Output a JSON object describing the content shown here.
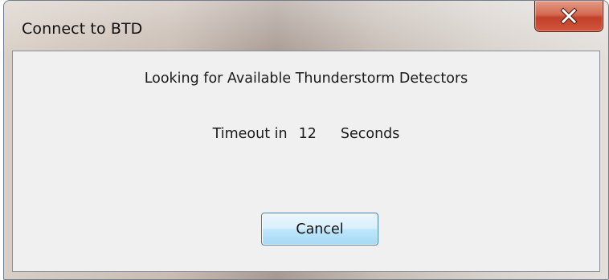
{
  "window": {
    "title": "Connect to BTD"
  },
  "title_bar": {
    "close_icon": "close-icon"
  },
  "dialog": {
    "message": "Looking for Available Thunderstorm Detectors",
    "timeout_label": "Timeout in",
    "timeout_value": "12",
    "timeout_unit": "Seconds",
    "cancel_label": "Cancel"
  },
  "colors": {
    "close_button": "#c7452e",
    "client_background": "#f0f0f0",
    "button_border": "#3c7fb1"
  }
}
